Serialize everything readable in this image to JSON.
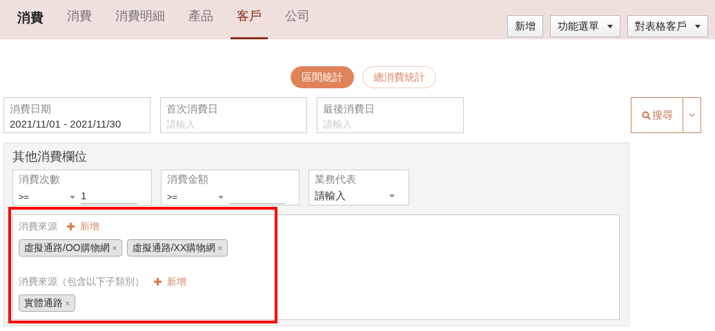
{
  "header": {
    "title": "消費",
    "tabs": [
      {
        "label": "消費",
        "selected": false
      },
      {
        "label": "消費明細",
        "selected": false
      },
      {
        "label": "產品",
        "selected": false
      },
      {
        "label": "客戶",
        "selected": true
      },
      {
        "label": "公司",
        "selected": false
      }
    ],
    "buttons": [
      {
        "label": "新增",
        "kind": "plain"
      },
      {
        "label": "功能選單",
        "kind": "dropdown"
      },
      {
        "label": "對表格客戶",
        "kind": "dropdown"
      }
    ]
  },
  "toggle": [
    {
      "label": "區間統計",
      "selected": true
    },
    {
      "label": "總消費統計",
      "selected": false
    }
  ],
  "date_fields": [
    {
      "label": "消費日期",
      "value": "2021/11/01 - 2021/11/30"
    },
    {
      "label": "首次消費日",
      "placeholder": "請輸入"
    },
    {
      "label": "最後消費日",
      "placeholder": "請輸入"
    }
  ],
  "search_button": {
    "label": "搜尋"
  },
  "other_fields": {
    "title": "其他消費欄位",
    "fields": [
      {
        "label": "消費次數",
        "kind": "compare",
        "operator": ">=",
        "value": "1"
      },
      {
        "label": "消費金額",
        "kind": "compare",
        "operator": ">="
      },
      {
        "label": "業務代表",
        "kind": "select",
        "placeholder": "請輸入"
      }
    ],
    "sources": {
      "highlighted": true,
      "groups": [
        {
          "label": "消費來源",
          "add": "新增",
          "tags": [
            "虛擬通路/OO購物網",
            "虛擬通路/XX購物網"
          ]
        },
        {
          "label": "消費來源（包含以下子類別）",
          "add": "新增",
          "tags": [
            "實體通路"
          ]
        }
      ]
    }
  }
}
